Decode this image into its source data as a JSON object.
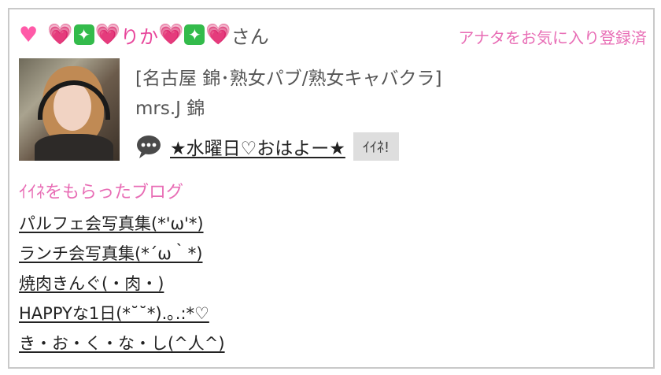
{
  "header": {
    "prefix_icons": [
      "heart-icon",
      "pink-heart-icon",
      "sparkle-icon",
      "pink-heart-icon"
    ],
    "name": "りか",
    "suffix_icons": [
      "pink-heart-icon",
      "sparkle-icon",
      "pink-heart-icon"
    ],
    "honorific": "さん",
    "favorite_status": "アナタをお気に入り登録済"
  },
  "profile": {
    "category": "[名古屋 錦･熟女パブ/熟女キャバクラ]",
    "shop": "mrs.J 錦",
    "latest_post": "★水曜日♡おはよー★",
    "like_button": "ｲｲﾈ!"
  },
  "liked_blogs": {
    "title": "ｲｲﾈをもらったブログ",
    "items": [
      "パルフェ会写真集(*'ω'*) ",
      "ランチ会写真集(*´ω｀*)",
      "焼肉きんぐ(・肉・)",
      "HAPPYな1日(*˘˘*).｡.:*♡",
      "き・お・く・な・し(^人^)"
    ]
  },
  "colors": {
    "accent_pink": "#e86db5",
    "heart_pink": "#ff5aa8",
    "sparkle_green": "#33bb4b",
    "like_button_bg": "#dedede"
  }
}
